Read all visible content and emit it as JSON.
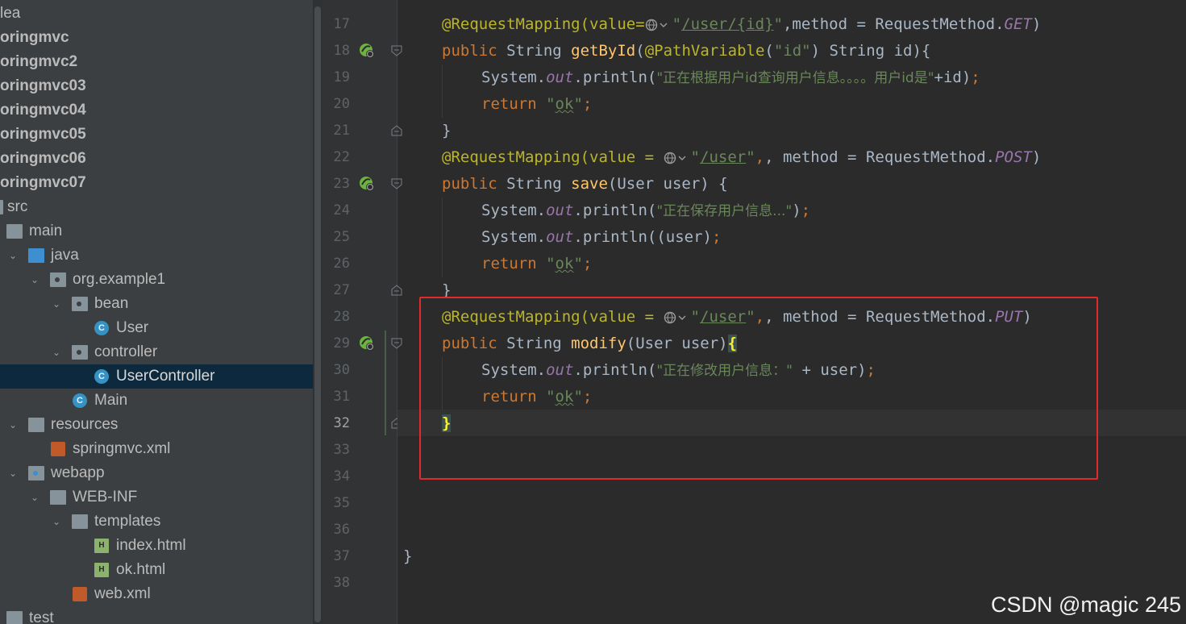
{
  "project_tree": {
    "items": [
      {
        "label": "lea",
        "bold": false
      },
      {
        "label": "oringmvc",
        "bold": true
      },
      {
        "label": "oringmvc2",
        "bold": true
      },
      {
        "label": "oringmvc03",
        "bold": true
      },
      {
        "label": "oringmvc04",
        "bold": true
      },
      {
        "label": "oringmvc05",
        "bold": true
      },
      {
        "label": "oringmvc06",
        "bold": true
      },
      {
        "label": "oringmvc07",
        "bold": true
      },
      {
        "label": "src"
      },
      {
        "label": "main"
      },
      {
        "label": "java"
      },
      {
        "label": "org.example1"
      },
      {
        "label": "bean"
      },
      {
        "label": "User"
      },
      {
        "label": "controller"
      },
      {
        "label": "UserController",
        "selected": true
      },
      {
        "label": "Main"
      },
      {
        "label": "resources"
      },
      {
        "label": "springmvc.xml"
      },
      {
        "label": "webapp"
      },
      {
        "label": "WEB-INF"
      },
      {
        "label": "templates"
      },
      {
        "label": "index.html"
      },
      {
        "label": "ok.html"
      },
      {
        "label": "web.xml"
      },
      {
        "label": "test"
      }
    ]
  },
  "editor": {
    "current_line": "32",
    "line_numbers": [
      "17",
      "18",
      "19",
      "20",
      "21",
      "22",
      "23",
      "24",
      "25",
      "26",
      "27",
      "28",
      "29",
      "30",
      "31",
      "32",
      "33",
      "34",
      "35",
      "36",
      "37",
      "38"
    ],
    "code": {
      "l17_prefix": "@RequestMapping(value=",
      "l17_path": "/user/{id}",
      "l17_rest": ",method = RequestMethod.",
      "l17_method": "GET",
      "l18_kw": "public",
      "l18_type": " String ",
      "l18_fn": "getById",
      "l18_ann": "@PathVariable",
      "l18_arg": "\"id\"",
      "l18_rest": " String id){",
      "l19_sys": "System.",
      "l19_out": "out",
      "l19_call": ".println(",
      "l19_str": "\"正在根据用户id查询用户信息。。。。用户id是\"",
      "l19_rest": "+id)",
      "return_kw": "return",
      "ok_q1": "\"",
      "ok_word": "ok",
      "ok_q2": "\"",
      "semicolon": ";",
      "close_brace": "}",
      "l22_prefix": "@RequestMapping(value = ",
      "l22_path": "/user",
      "l22_rest": ", method = RequestMethod.",
      "l22_method": "POST",
      "l23_fn": "save",
      "l23_rest": "(User user) {",
      "l24_str": "\"正在保存用户信息...\"",
      "l25_rest": "(user)",
      "l28_method": "PUT",
      "l29_fn": "modify",
      "l29_rest": "(User user)",
      "l29_brace": "{",
      "l30_str": "\"正在修改用户信息：\"",
      "l30_rest": " + user)",
      "l37_brace": "}",
      "quote": "\"",
      "paren_close": ")",
      "type_string": " String "
    }
  },
  "watermark": "CSDN @magic 245",
  "colors": {
    "highlight_box": "#e02b2b",
    "selection": "#0d293e",
    "annotation": "#bbb529",
    "keyword": "#cc7832",
    "string": "#6a8759",
    "function": "#ffc66d"
  }
}
